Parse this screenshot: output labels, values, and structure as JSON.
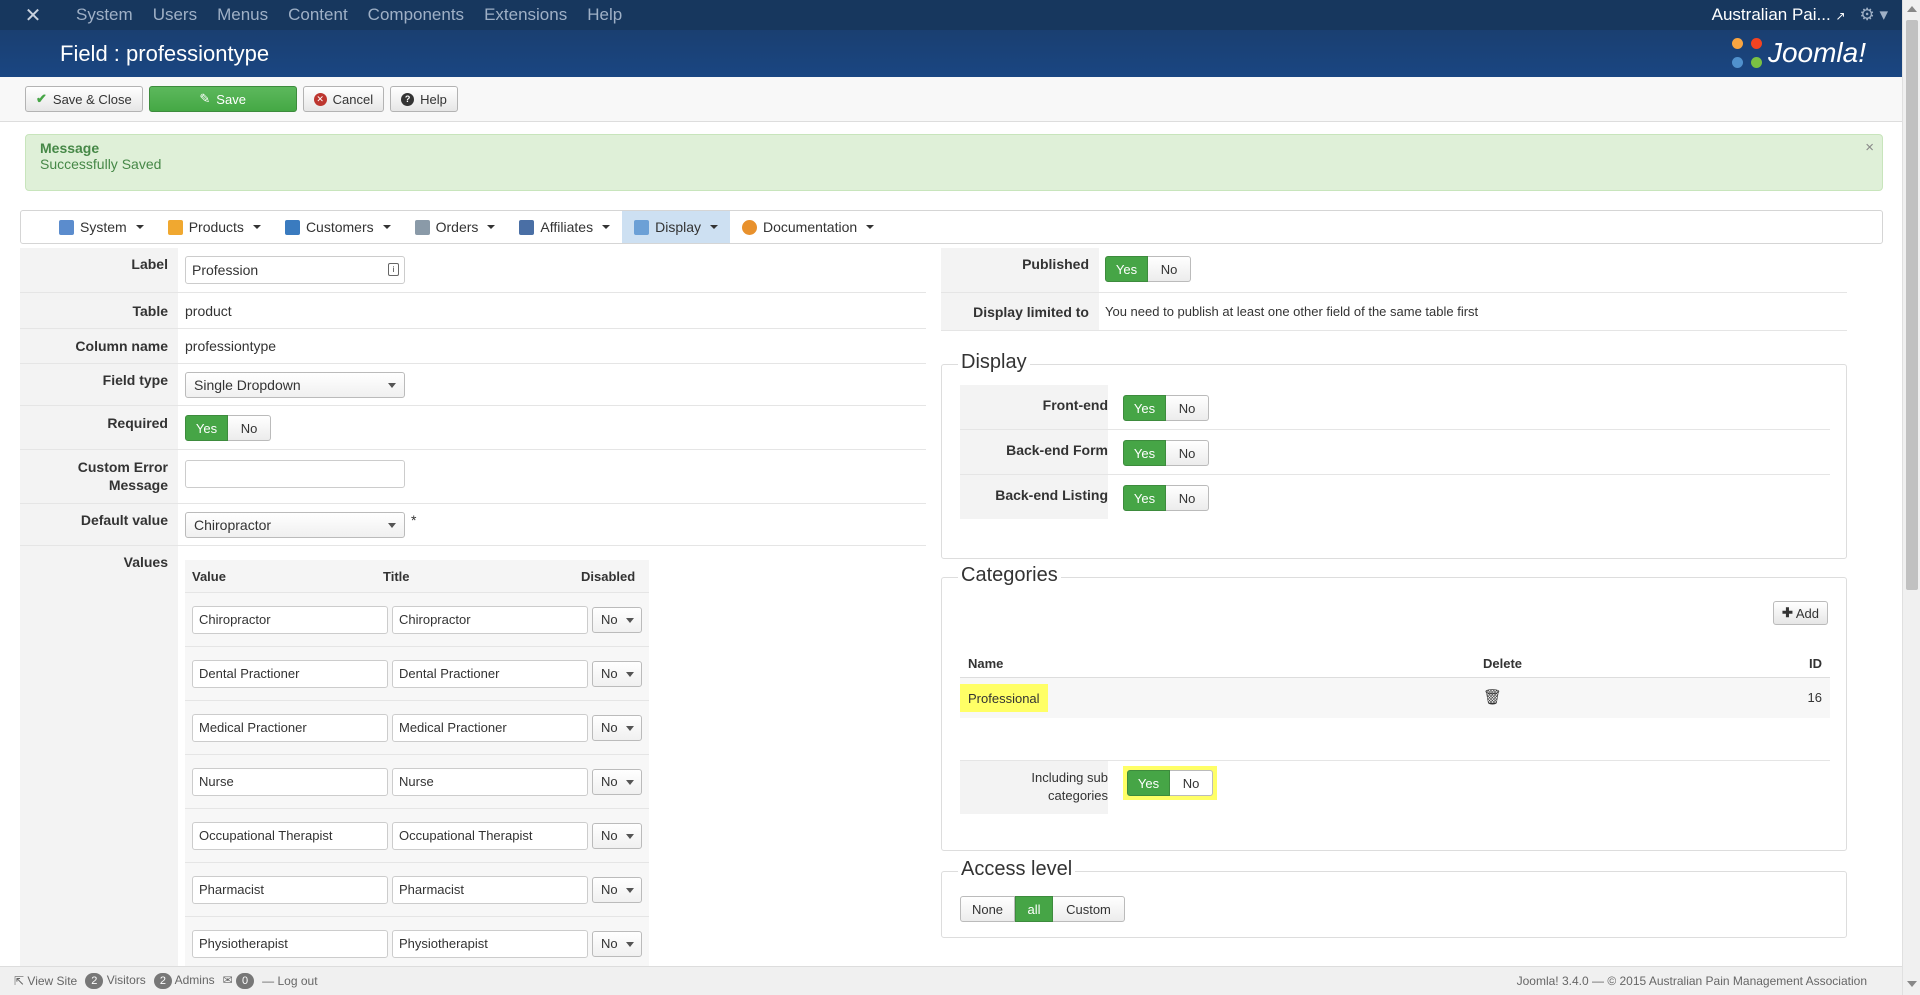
{
  "topnav": {
    "menu": [
      "System",
      "Users",
      "Menus",
      "Content",
      "Components",
      "Extensions",
      "Help"
    ],
    "site_name": "Australian Pai..."
  },
  "header": {
    "title": "Field : professiontype",
    "logo_text": "Joomla!"
  },
  "toolbar": {
    "save_close": "Save & Close",
    "save": "Save",
    "cancel": "Cancel",
    "help": "Help"
  },
  "message": {
    "title": "Message",
    "body": "Successfully Saved",
    "close": "×"
  },
  "submenu": {
    "items": [
      "System",
      "Products",
      "Customers",
      "Orders",
      "Affiliates",
      "Display",
      "Documentation"
    ],
    "active": "Display"
  },
  "form": {
    "label": {
      "label": "Label",
      "value": "Profession"
    },
    "table": {
      "label": "Table",
      "value": "product"
    },
    "column": {
      "label": "Column name",
      "value": "professiontype"
    },
    "field_type": {
      "label": "Field type",
      "value": "Single Dropdown"
    },
    "required": {
      "label": "Required",
      "yes": "Yes",
      "no": "No"
    },
    "custom_error": {
      "label_line1": "Custom Error",
      "label_line2": "Message",
      "value": ""
    },
    "default_value": {
      "label": "Default value",
      "value": "Chiropractor",
      "star": "*"
    },
    "values": {
      "label": "Values",
      "headers": {
        "value": "Value",
        "title": "Title",
        "disabled": "Disabled"
      },
      "rows": [
        {
          "value": "Chiropractor",
          "title": "Chiropractor",
          "disabled": "No"
        },
        {
          "value": "Dental Practioner",
          "title": "Dental Practioner",
          "disabled": "No"
        },
        {
          "value": "Medical Practioner",
          "title": "Medical Practioner",
          "disabled": "No"
        },
        {
          "value": "Nurse",
          "title": "Nurse",
          "disabled": "No"
        },
        {
          "value": "Occupational Therapist",
          "title": "Occupational Therapist",
          "disabled": "No"
        },
        {
          "value": "Pharmacist",
          "title": "Pharmacist",
          "disabled": "No"
        },
        {
          "value": "Physiotherapist",
          "title": "Physiotherapist",
          "disabled": "No"
        }
      ]
    }
  },
  "right": {
    "published": {
      "label": "Published",
      "yes": "Yes",
      "no": "No"
    },
    "display_limited": {
      "label": "Display limited to",
      "value": "You need to publish at least one other field of the same table first"
    },
    "display": {
      "legend": "Display",
      "frontend": "Front-end",
      "backend_form": "Back-end Form",
      "backend_listing": "Back-end Listing",
      "yes": "Yes",
      "no": "No"
    },
    "categories": {
      "legend": "Categories",
      "add": "Add",
      "headers": {
        "name": "Name",
        "delete": "Delete",
        "id": "ID"
      },
      "rows": [
        {
          "name": "Professional",
          "id": "16"
        }
      ],
      "including_line1": "Including sub",
      "including_line2": "categories",
      "yes": "Yes",
      "no": "No"
    },
    "access": {
      "legend": "Access level",
      "none": "None",
      "all": "all",
      "custom": "Custom"
    }
  },
  "status": {
    "view_site": "View Site",
    "visitors_count": "2",
    "visitors": "Visitors",
    "admins_count": "2",
    "admins": "Admins",
    "messages_count": "0",
    "logout": "Log out",
    "footer": "Joomla! 3.4.0 — © 2015 Australian Pain Management Association"
  }
}
